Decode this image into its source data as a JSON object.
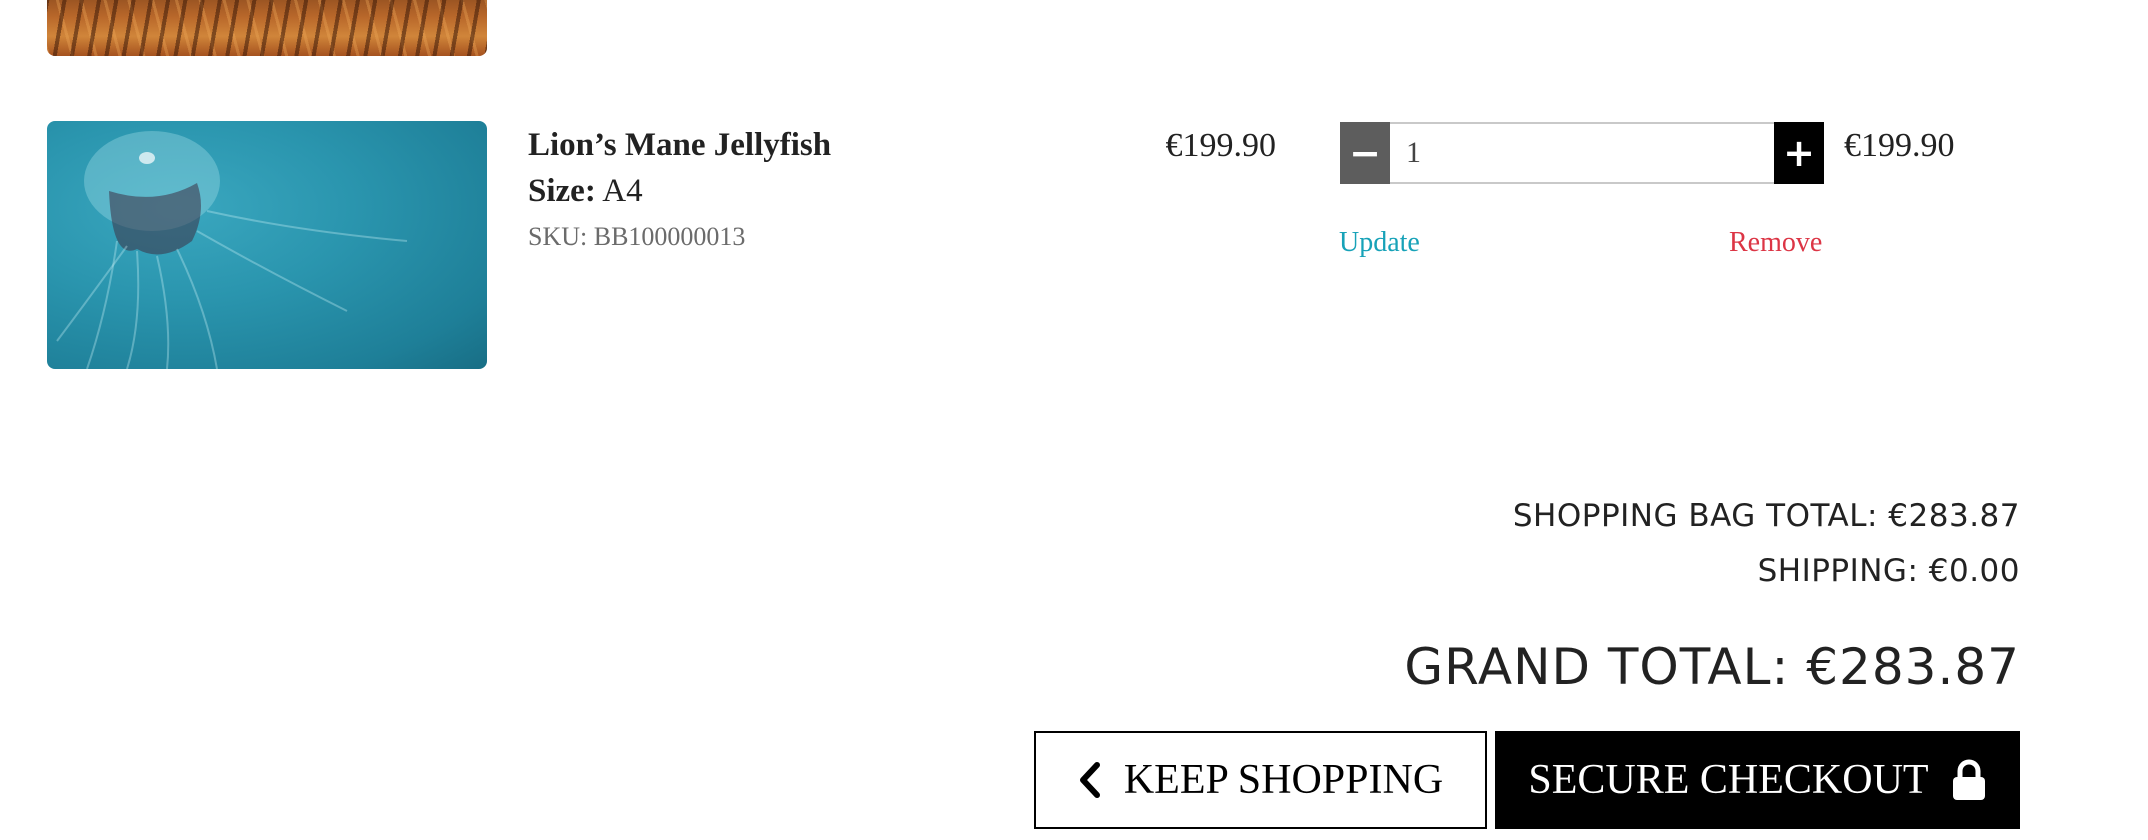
{
  "cart_item": {
    "name": "Lion’s Mane Jellyfish",
    "size_label": "Size:",
    "size_value": "A4",
    "sku": "SKU: BB100000013",
    "price": "€199.90",
    "quantity": "1",
    "subtotal": "€199.90",
    "update_label": "Update",
    "remove_label": "Remove",
    "decrement_symbol": "−",
    "increment_symbol": "+"
  },
  "summary": {
    "bag_total": "SHOPPING BAG TOTAL: €283.87",
    "shipping": "SHIPPING: €0.00",
    "grand_total": "GRAND TOTAL: €283.87"
  },
  "actions": {
    "keep_shopping": "KEEP SHOPPING",
    "secure_checkout": "SECURE CHECKOUT"
  },
  "icons": {
    "keep_shopping_icon": "chevron-left-icon",
    "checkout_icon": "lock-icon"
  },
  "colors": {
    "update_link": "#17a2b8",
    "remove_link": "#dc3545",
    "primary_button": "#000000",
    "decrement_button": "#5d5d5d"
  }
}
